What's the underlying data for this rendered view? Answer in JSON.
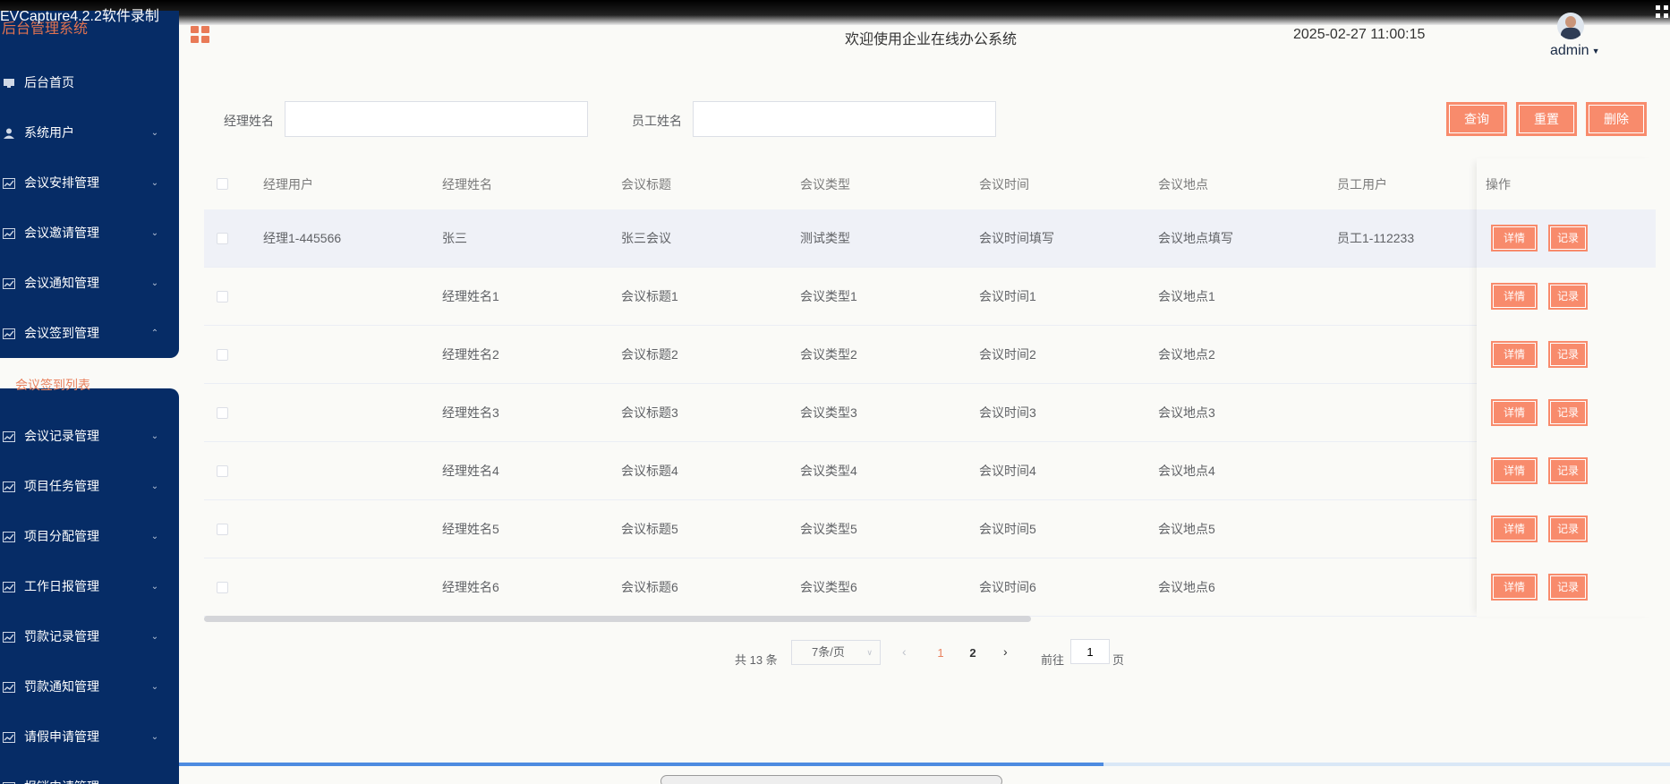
{
  "recorder": {
    "title": "EVCapture4.2.2软件录制",
    "progress": 0.62
  },
  "sidebar": {
    "brand": "后台管理系统",
    "items": [
      {
        "label": "后台首页",
        "icon": "monitor-icon",
        "expandable": false
      },
      {
        "label": "系统用户",
        "icon": "user-icon",
        "expandable": true
      },
      {
        "label": "会议安排管理",
        "icon": "chart-icon",
        "expandable": true
      },
      {
        "label": "会议邀请管理",
        "icon": "chart-icon",
        "expandable": true
      },
      {
        "label": "会议通知管理",
        "icon": "chart-icon",
        "expandable": true
      },
      {
        "label": "会议签到管理",
        "icon": "chart-icon",
        "expandable": true,
        "expanded": true
      },
      {
        "label": "会议记录管理",
        "icon": "chart-icon",
        "expandable": true
      },
      {
        "label": "项目任务管理",
        "icon": "chart-icon",
        "expandable": true
      },
      {
        "label": "项目分配管理",
        "icon": "chart-icon",
        "expandable": true
      },
      {
        "label": "工作日报管理",
        "icon": "chart-icon",
        "expandable": true
      },
      {
        "label": "罚款记录管理",
        "icon": "chart-icon",
        "expandable": true
      },
      {
        "label": "罚款通知管理",
        "icon": "chart-icon",
        "expandable": true
      },
      {
        "label": "请假申请管理",
        "icon": "chart-icon",
        "expandable": true
      },
      {
        "label": "报销申请管理",
        "icon": "chart-icon",
        "expandable": true
      }
    ],
    "sub_item": "会议签到列表"
  },
  "header": {
    "welcome": "欢迎使用企业在线办公系统",
    "datetime": "2025-02-27 11:00:15",
    "user": "admin"
  },
  "search": {
    "manager_label": "经理姓名",
    "manager_value": "",
    "employee_label": "员工姓名",
    "employee_value": "",
    "query_btn": "查询",
    "reset_btn": "重置",
    "delete_btn": "删除"
  },
  "table": {
    "headers": [
      "经理用户",
      "经理姓名",
      "会议标题",
      "会议类型",
      "会议时间",
      "会议地点",
      "员工用户"
    ],
    "action_header": "操作",
    "detail_btn": "详情",
    "record_btn": "记录",
    "rows": [
      [
        "经理1-445566",
        "张三",
        "张三会议",
        "测试类型",
        "会议时间填写",
        "会议地点填写",
        "员工1-112233"
      ],
      [
        "",
        "经理姓名1",
        "会议标题1",
        "会议类型1",
        "会议时间1",
        "会议地点1",
        ""
      ],
      [
        "",
        "经理姓名2",
        "会议标题2",
        "会议类型2",
        "会议时间2",
        "会议地点2",
        ""
      ],
      [
        "",
        "经理姓名3",
        "会议标题3",
        "会议类型3",
        "会议时间3",
        "会议地点3",
        ""
      ],
      [
        "",
        "经理姓名4",
        "会议标题4",
        "会议类型4",
        "会议时间4",
        "会议地点4",
        ""
      ],
      [
        "",
        "经理姓名5",
        "会议标题5",
        "会议类型5",
        "会议时间5",
        "会议地点5",
        ""
      ],
      [
        "",
        "经理姓名6",
        "会议标题6",
        "会议类型6",
        "会议时间6",
        "会议地点6",
        ""
      ]
    ]
  },
  "pagination": {
    "total": "共 13 条",
    "page_size": "7条/页",
    "pages": [
      "1",
      "2"
    ],
    "current": "1",
    "goto_label": "前往",
    "goto_value": "1",
    "page_suffix": "页"
  },
  "colors": {
    "sidebar": "#062c66",
    "accent": "#f88b6c",
    "brand": "#e07250"
  }
}
